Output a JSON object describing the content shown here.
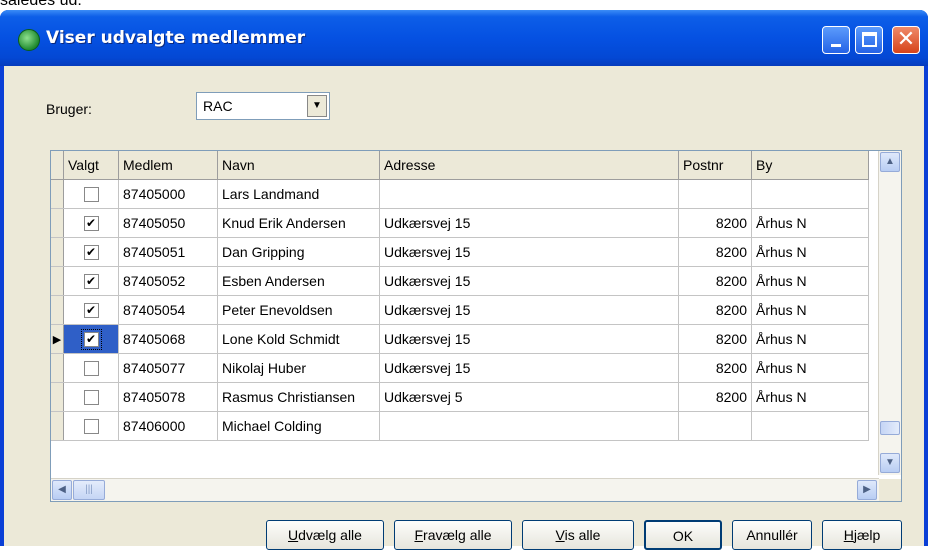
{
  "top_text": "således ud:",
  "window": {
    "title": "Viser udvalgte medlemmer",
    "icons": {
      "app": "club-icon",
      "minimize": "minimize-icon",
      "maximize": "maximize-icon",
      "close": "close-icon"
    }
  },
  "filter": {
    "label": "Bruger:",
    "selected": "RAC",
    "dropdown_icon": "chevron-down-icon"
  },
  "grid": {
    "columns": [
      "Valgt",
      "Medlem",
      "Navn",
      "Adresse",
      "Postnr",
      "By"
    ],
    "rows": [
      {
        "checked": false,
        "medlem": "87405000",
        "navn": "Lars Landmand",
        "adresse": "",
        "postnr": "",
        "by": ""
      },
      {
        "checked": true,
        "medlem": "87405050",
        "navn": "Knud Erik Andersen",
        "adresse": "Udkærsvej 15",
        "postnr": "8200",
        "by": "Århus N"
      },
      {
        "checked": true,
        "medlem": "87405051",
        "navn": "Dan Gripping",
        "adresse": "Udkærsvej 15",
        "postnr": "8200",
        "by": "Århus N"
      },
      {
        "checked": true,
        "medlem": "87405052",
        "navn": "Esben Andersen",
        "adresse": "Udkærsvej 15",
        "postnr": "8200",
        "by": "Århus N"
      },
      {
        "checked": true,
        "medlem": "87405054",
        "navn": "Peter Enevoldsen",
        "adresse": "Udkærsvej 15",
        "postnr": "8200",
        "by": "Århus N"
      },
      {
        "checked": true,
        "current": true,
        "medlem": "87405068",
        "navn": "Lone Kold Schmidt",
        "adresse": "Udkærsvej 15",
        "postnr": "8200",
        "by": "Århus N"
      },
      {
        "checked": false,
        "medlem": "87405077",
        "navn": "Nikolaj Huber",
        "adresse": "Udkærsvej 15",
        "postnr": "8200",
        "by": "Århus N"
      },
      {
        "checked": false,
        "medlem": "87405078",
        "navn": "Rasmus Christiansen",
        "adresse": "Udkærsvej 5",
        "postnr": "8200",
        "by": "Århus N"
      },
      {
        "checked": false,
        "medlem": "87406000",
        "navn": "Michael Colding",
        "adresse": "",
        "postnr": "",
        "by": ""
      }
    ],
    "row_indicator": "▶"
  },
  "buttons": {
    "select_all": {
      "mnemonic": "U",
      "rest": "dvælg alle"
    },
    "deselect_all": {
      "mnemonic": "F",
      "rest": "ravælg alle"
    },
    "show_all": {
      "mnemonic": "V",
      "rest": "is alle"
    },
    "ok": "OK",
    "cancel": "Annullér",
    "help": {
      "mnemonic": "H",
      "rest": "jælp"
    }
  }
}
